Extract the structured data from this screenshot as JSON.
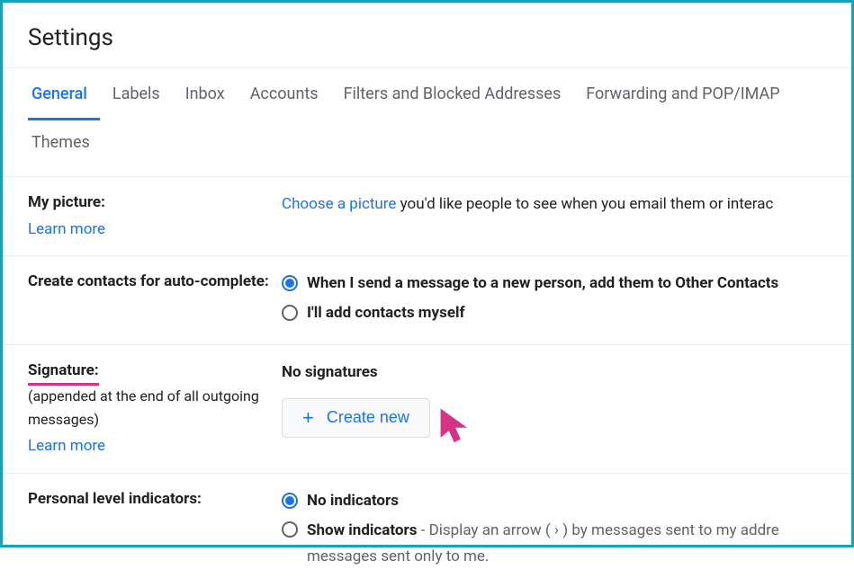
{
  "header": {
    "title": "Settings"
  },
  "tabs": {
    "general": "General",
    "labels": "Labels",
    "inbox": "Inbox",
    "accounts": "Accounts",
    "filters": "Filters and Blocked Addresses",
    "forwarding": "Forwarding and POP/IMAP",
    "themes": "Themes"
  },
  "picture": {
    "label": "My picture:",
    "learn_more": "Learn more",
    "link_text": "Choose a picture",
    "desc_text": " you'd like people to see when you email them or interac"
  },
  "autocomplete": {
    "label": "Create contacts for auto-complete:",
    "opt1": "When I send a message to a new person, add them to Other Contacts",
    "opt2": "I'll add contacts myself"
  },
  "signature": {
    "label": "Signature:",
    "sub": "(appended at the end of all outgoing messages)",
    "learn_more": "Learn more",
    "no_sig": "No signatures",
    "create_new": "Create new"
  },
  "indicators": {
    "label": "Personal level indicators:",
    "opt1": "No indicators",
    "opt2_label": "Show indicators",
    "opt2_desc": " - Display an arrow ( › ) by messages sent to my addre",
    "opt2_line2": "messages sent only to me."
  }
}
